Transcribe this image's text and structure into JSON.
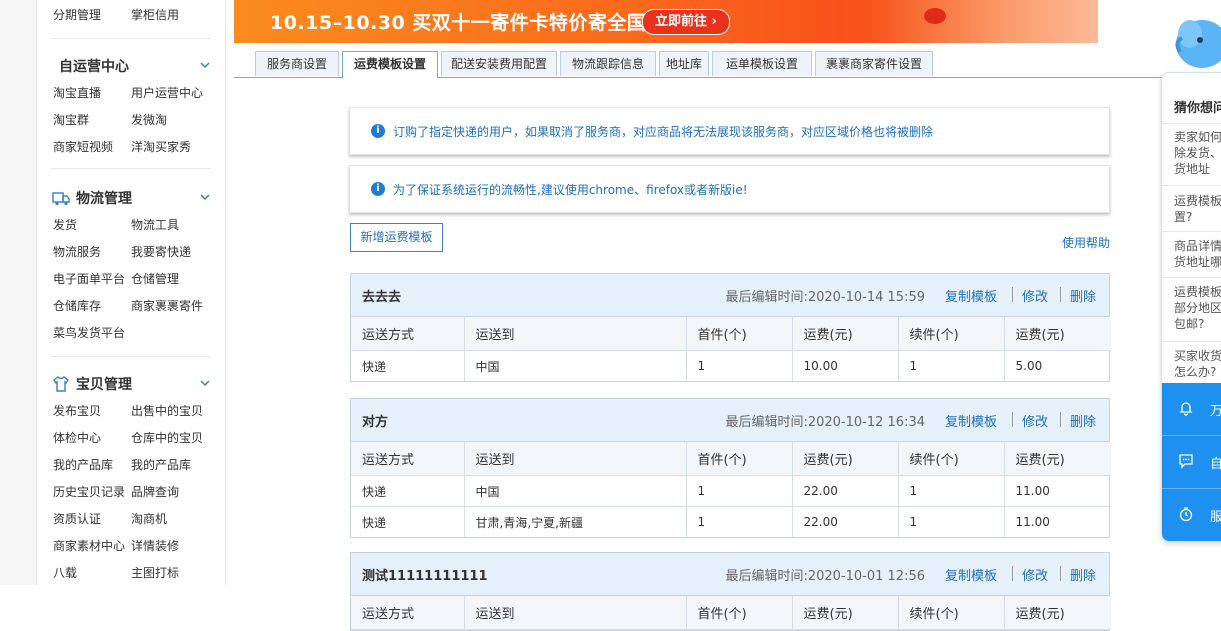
{
  "sidebar": {
    "top_row": [
      "分期管理",
      "掌柜信用"
    ],
    "section_self": {
      "title": "自运营中心",
      "items": [
        [
          "淘宝直播",
          "用户运营中心"
        ],
        [
          "淘宝群",
          "发微淘"
        ],
        [
          "商家短视频",
          "洋淘买家秀"
        ]
      ]
    },
    "section_logistics": {
      "title": "物流管理",
      "items": [
        [
          "发货",
          "物流工具"
        ],
        [
          "物流服务",
          "我要寄快递"
        ],
        [
          "电子面单平台",
          "仓储管理"
        ],
        [
          "仓储库存",
          "商家裹裹寄件"
        ],
        [
          "菜鸟发货平台",
          ""
        ]
      ]
    },
    "section_goods": {
      "title": "宝贝管理",
      "items": [
        [
          "发布宝贝",
          "出售中的宝贝"
        ],
        [
          "体检中心",
          "仓库中的宝贝"
        ],
        [
          "我的产品库",
          "我的产品库"
        ],
        [
          "历史宝贝记录",
          "品牌查询"
        ],
        [
          "资质认证",
          "淘商机"
        ],
        [
          "商家素材中心",
          "详情装修"
        ],
        [
          "八载",
          "主图打标"
        ]
      ]
    }
  },
  "banner": {
    "text": "10.15–10.30 买双十一寄件卡特价寄全国",
    "button": "立即前往 ›"
  },
  "tabs": [
    "服务商设置",
    "运费模板设置",
    "配送安装费用配置",
    "物流跟踪信息",
    "地址库",
    "运单模板设置",
    "裹裹商家寄件设置"
  ],
  "active_tab_index": 1,
  "notices": [
    "订购了指定快递的用户，如果取消了服务商，对应商品将无法展现该服务商，对应区域价格也将被删除",
    "为了保证系统运行的流畅性,建议使用chrome、firefox或者新版ie!"
  ],
  "add_button": "新增运费模板",
  "help_link": "使用帮助",
  "table_headers": [
    "运送方式",
    "运送到",
    "首件(个)",
    "运费(元)",
    "续件(个)",
    "运费(元)"
  ],
  "actions": {
    "copy": "复制模板",
    "edit": "修改",
    "delete": "删除"
  },
  "templates": [
    {
      "name": "去去去",
      "time": "最后编辑时间:2020-10-14 15:59",
      "rows": [
        [
          "快递",
          "中国",
          "1",
          "10.00",
          "1",
          "5.00"
        ]
      ]
    },
    {
      "name": "对方",
      "time": "最后编辑时间:2020-10-12 16:34",
      "rows": [
        [
          "快递",
          "中国",
          "1",
          "22.00",
          "1",
          "11.00"
        ],
        [
          "快递",
          "甘肃,青海,宁夏,新疆",
          "1",
          "22.00",
          "1",
          "11.00"
        ]
      ]
    },
    {
      "name": "测试11111111111",
      "time": "最后编辑时间:2020-10-01 12:56",
      "rows": []
    }
  ],
  "right_panel": {
    "title": "猜你想问",
    "questions": [
      "卖家如何\n除发货、\n货地址",
      "运费模板\n置?",
      "商品详情\n货地址哪",
      "运费模板\n部分地区\n包邮?",
      "买家收货\n怎么办?"
    ],
    "buttons": [
      "万",
      "自",
      "服"
    ]
  },
  "colors": {
    "link": "#1d6fc2",
    "accent_blue": "#1e90f0",
    "banner_orange": "#fa6a1c",
    "header_bg": "#e6f0fb"
  }
}
